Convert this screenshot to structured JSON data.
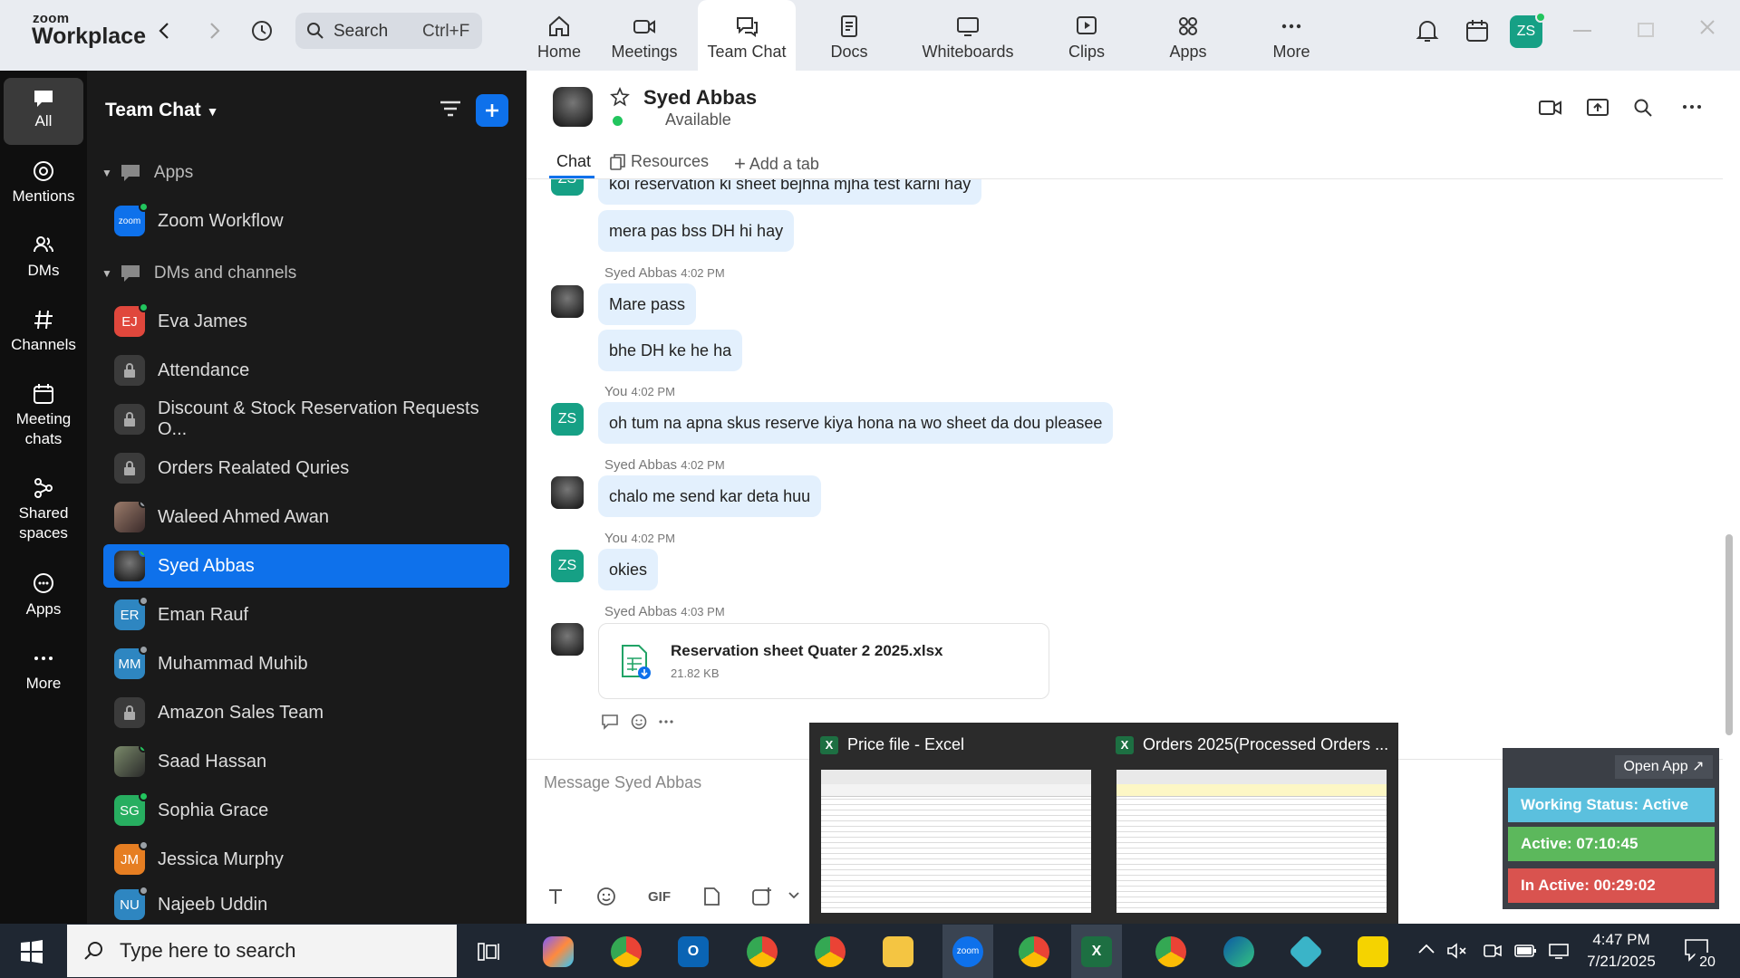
{
  "app": {
    "logo_top": "zoom",
    "logo_bottom": "Workplace"
  },
  "search": {
    "label": "Search",
    "shortcut": "Ctrl+F"
  },
  "tabs": [
    {
      "label": "Home"
    },
    {
      "label": "Meetings"
    },
    {
      "label": "Team Chat"
    },
    {
      "label": "Docs"
    },
    {
      "label": "Whiteboards"
    },
    {
      "label": "Clips"
    },
    {
      "label": "Apps"
    },
    {
      "label": "More"
    }
  ],
  "user_initials": "ZS",
  "rail": [
    {
      "label": "All"
    },
    {
      "label": "Mentions"
    },
    {
      "label": "DMs"
    },
    {
      "label": "Channels"
    },
    {
      "label": "Meeting chats"
    },
    {
      "label": "Shared spaces"
    },
    {
      "label": "Apps"
    },
    {
      "label": "More"
    }
  ],
  "sidebar": {
    "title": "Team Chat",
    "sections": [
      {
        "label": "Apps"
      },
      {
        "label": "DMs and channels"
      }
    ],
    "app_items": [
      {
        "label": "Zoom Workflow",
        "badge": "zoom"
      }
    ],
    "items": [
      {
        "label": "Eva James",
        "initials": "EJ"
      },
      {
        "label": "Attendance"
      },
      {
        "label": "Discount & Stock Reservation Requests O..."
      },
      {
        "label": "Orders Realated Quries"
      },
      {
        "label": "Waleed Ahmed Awan"
      },
      {
        "label": "Syed Abbas"
      },
      {
        "label": "Eman Rauf",
        "initials": "ER"
      },
      {
        "label": "Muhammad Muhib",
        "initials": "MM"
      },
      {
        "label": "Amazon Sales Team"
      },
      {
        "label": "Saad Hassan"
      },
      {
        "label": "Sophia Grace",
        "initials": "SG"
      },
      {
        "label": "Jessica Murphy",
        "initials": "JM"
      },
      {
        "label": "Najeeb Uddin",
        "initials": "NU"
      }
    ]
  },
  "chat": {
    "name": "Syed Abbas",
    "status": "Available",
    "tabs": {
      "chat": "Chat",
      "resources": "Resources",
      "add": "Add a tab"
    },
    "messages": {
      "m0": "koi reservation ki sheet bejhna mjha test karni hay",
      "m1": "mera pas bss DH hi hay",
      "g1_sender": "Syed Abbas",
      "g1_time": "4:02 PM",
      "m2": "Mare pass",
      "m3": "bhe DH ke he ha",
      "g2_sender": "You",
      "g2_time": "4:02 PM",
      "m4": "oh tum na apna skus reserve kiya hona na wo sheet da dou pleasee",
      "g3_sender": "Syed Abbas",
      "g3_time": "4:02 PM",
      "m5": "chalo me send kar deta huu",
      "g4_sender": "You",
      "g4_time": "4:02 PM",
      "m6": "okies",
      "g5_sender": "Syed Abbas",
      "g5_time": "4:03 PM"
    },
    "file": {
      "name": "Reservation sheet Quater 2 2025.xlsx",
      "size": "21.82 KB"
    },
    "compose_placeholder": "Message Syed Abbas",
    "gif_label": "GIF"
  },
  "preview": {
    "items": [
      {
        "title": "Price file - Excel"
      },
      {
        "title": "Orders 2025(Processed Orders ..."
      }
    ]
  },
  "widget": {
    "open_app": "Open App ↗",
    "working_status": "Working Status: Active",
    "active": "Active: 07:10:45",
    "inactive": "In Active: 00:29:02"
  },
  "taskbar": {
    "search_placeholder": "Type here to search",
    "time": "4:47 PM",
    "date": "7/21/2025",
    "notifications": "20"
  },
  "colors": {
    "accent": "#0e71eb",
    "sidebar_bg": "#1a1a1a",
    "rail_bg": "#0f0f0f",
    "bubble": "#e3f0fd"
  }
}
